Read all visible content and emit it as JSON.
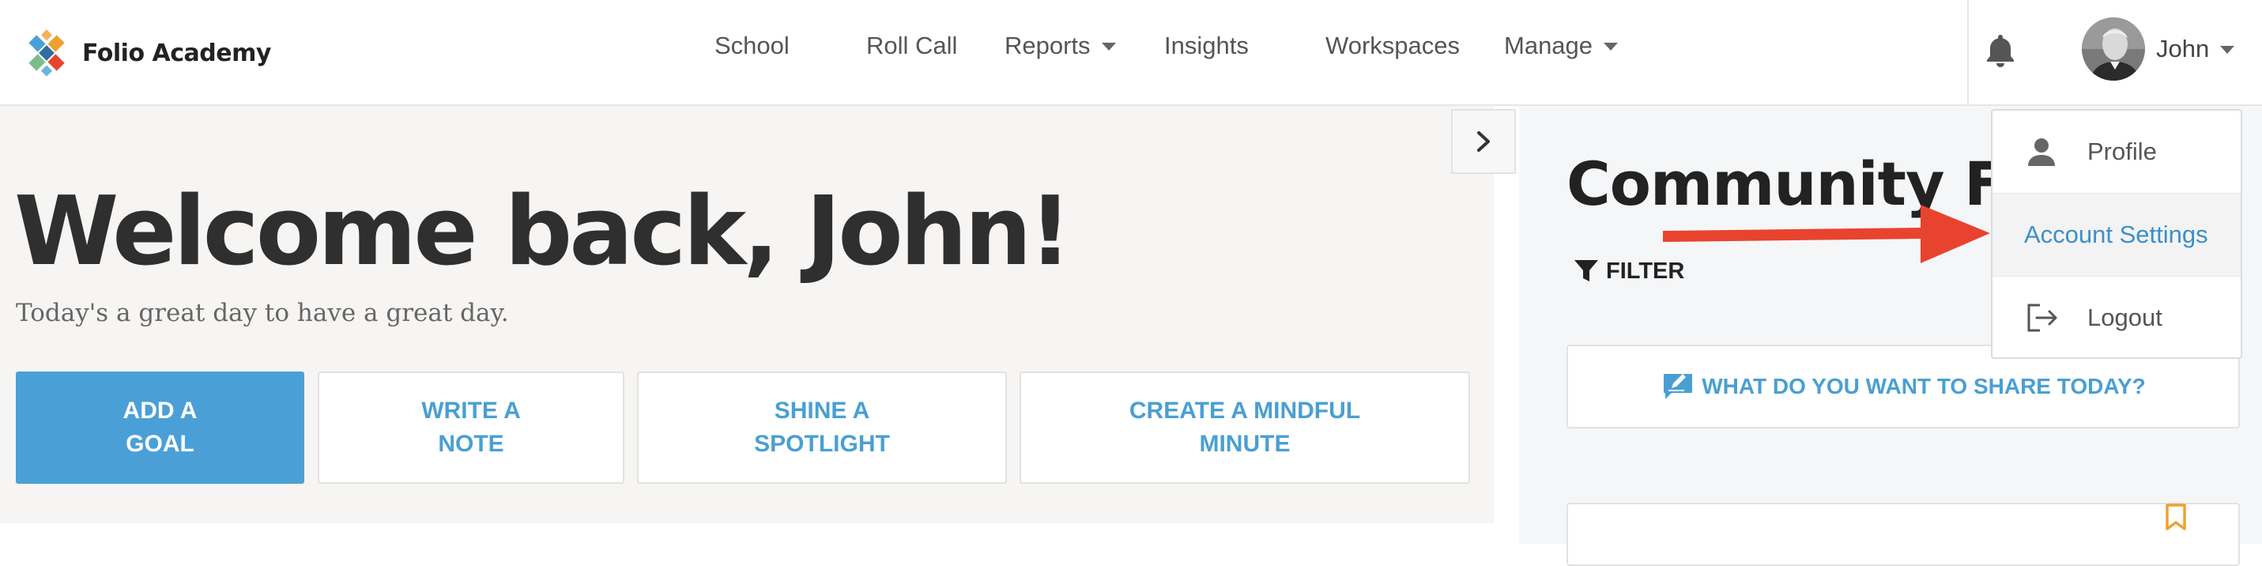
{
  "brand": {
    "name": "Folio Academy"
  },
  "nav": {
    "items": [
      {
        "label": "School",
        "has_caret": false
      },
      {
        "label": "Roll Call",
        "has_caret": false
      },
      {
        "label": "Reports",
        "has_caret": true
      },
      {
        "label": "Insights",
        "has_caret": false
      },
      {
        "label": "Workspaces",
        "has_caret": false
      },
      {
        "label": "Manage",
        "has_caret": true
      }
    ]
  },
  "user": {
    "name": "John"
  },
  "hero": {
    "title": "Welcome back, John!",
    "subtitle": "Today's a great day to have a great day.",
    "actions": [
      {
        "label": "ADD A\nGOAL"
      },
      {
        "label": "WRITE A\nNOTE"
      },
      {
        "label": "SHINE A\nSPOTLIGHT"
      },
      {
        "label": "CREATE A MINDFUL\nMINUTE"
      }
    ]
  },
  "feed": {
    "title": "Community Feed",
    "filter_label": "FILTER",
    "share_prompt": "WHAT DO YOU WANT TO SHARE TODAY?"
  },
  "user_menu": {
    "items": [
      {
        "label": "Profile",
        "icon": "person-icon"
      },
      {
        "label": "Account Settings",
        "icon": "",
        "highlighted": true
      },
      {
        "label": "Logout",
        "icon": "logout-icon"
      }
    ]
  },
  "colors": {
    "accent": "#4aa0d6",
    "hero_bg": "#f7f5f3",
    "feed_bg": "#f5f6f7",
    "annotation_arrow": "#e8432e",
    "bookmark": "#f0a030"
  }
}
